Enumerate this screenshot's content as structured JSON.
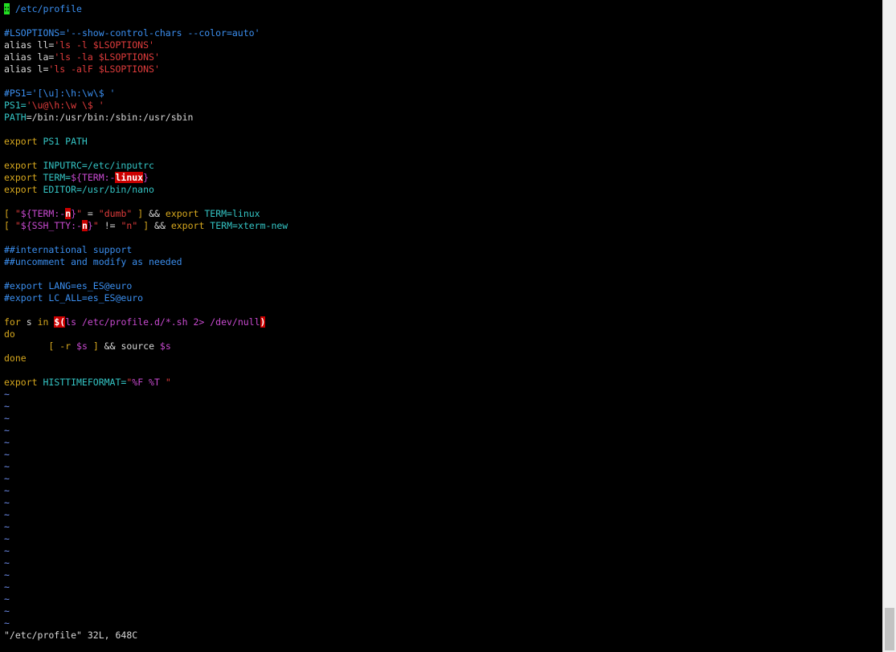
{
  "colors": {
    "background": "#000000",
    "default": "#d8d8d8",
    "comment": "#3b8ff0",
    "string": "#e03c3c",
    "keyword": "#d7a81e",
    "identifier": "#34c5c5",
    "special": "#c84ad0",
    "tilde": "#6f8ff0",
    "highlight_bg": "#cc0000",
    "cursor_bg": "#22e022"
  },
  "editor": {
    "file_name": "/etc/profile",
    "cursor_icon": "block-cursor",
    "status_line": "\"/etc/profile\" 32L, 648C",
    "empty_line_marker": "~",
    "lines": [
      [
        {
          "t": "",
          "c": "cursor"
        },
        {
          "t": " /etc/profile",
          "c": "comment"
        }
      ],
      [],
      [
        {
          "t": "#LSOPTIONS=",
          "c": "comment"
        },
        {
          "t": "'--show-control-chars --color=auto'",
          "c": "comment"
        }
      ],
      [
        {
          "t": "alias ll=",
          "c": "default"
        },
        {
          "t": "'ls -l ",
          "c": "string"
        },
        {
          "t": "$LSOPTIONS",
          "c": "string"
        },
        {
          "t": "'",
          "c": "string"
        }
      ],
      [
        {
          "t": "alias la=",
          "c": "default"
        },
        {
          "t": "'ls -la ",
          "c": "string"
        },
        {
          "t": "$LSOPTIONS",
          "c": "string"
        },
        {
          "t": "'",
          "c": "string"
        }
      ],
      [
        {
          "t": "alias l=",
          "c": "default"
        },
        {
          "t": "'ls -alF ",
          "c": "string"
        },
        {
          "t": "$LSOPTIONS",
          "c": "string"
        },
        {
          "t": "'",
          "c": "string"
        }
      ],
      [],
      [
        {
          "t": "#PS1='[\\u]:\\h:\\w\\$ '",
          "c": "comment"
        }
      ],
      [
        {
          "t": "PS1=",
          "c": "identifier"
        },
        {
          "t": "'\\u@\\h:\\w \\$ '",
          "c": "string"
        }
      ],
      [
        {
          "t": "PATH",
          "c": "identifier"
        },
        {
          "t": "=/bin:/usr/bin:/sbin:/usr/sbin",
          "c": "default"
        }
      ],
      [],
      [
        {
          "t": "export ",
          "c": "keyword"
        },
        {
          "t": "PS1 PATH",
          "c": "identifier"
        }
      ],
      [],
      [
        {
          "t": "export ",
          "c": "keyword"
        },
        {
          "t": "INPUTRC=/etc/inputrc",
          "c": "identifier"
        }
      ],
      [
        {
          "t": "export ",
          "c": "keyword"
        },
        {
          "t": "TERM=",
          "c": "identifier"
        },
        {
          "t": "${TERM:-",
          "c": "special"
        },
        {
          "t": "linux",
          "c": "hl"
        },
        {
          "t": "}",
          "c": "special"
        }
      ],
      [
        {
          "t": "export ",
          "c": "keyword"
        },
        {
          "t": "EDITOR=/usr/bin/nano",
          "c": "identifier"
        }
      ],
      [],
      [
        {
          "t": "[ ",
          "c": "keyword"
        },
        {
          "t": "\"",
          "c": "string"
        },
        {
          "t": "${TERM:-",
          "c": "special"
        },
        {
          "t": "n",
          "c": "hl"
        },
        {
          "t": "}",
          "c": "special"
        },
        {
          "t": "\"",
          "c": "string"
        },
        {
          "t": " = ",
          "c": "default"
        },
        {
          "t": "\"dumb\"",
          "c": "string"
        },
        {
          "t": " ] ",
          "c": "keyword"
        },
        {
          "t": "&& ",
          "c": "default"
        },
        {
          "t": "export ",
          "c": "keyword"
        },
        {
          "t": "TERM=linux",
          "c": "identifier"
        }
      ],
      [
        {
          "t": "[ ",
          "c": "keyword"
        },
        {
          "t": "\"",
          "c": "string"
        },
        {
          "t": "${SSH_TTY:-",
          "c": "special"
        },
        {
          "t": "n",
          "c": "hl"
        },
        {
          "t": "}",
          "c": "special"
        },
        {
          "t": "\"",
          "c": "string"
        },
        {
          "t": " != ",
          "c": "default"
        },
        {
          "t": "\"n\"",
          "c": "string"
        },
        {
          "t": " ] ",
          "c": "keyword"
        },
        {
          "t": "&& ",
          "c": "default"
        },
        {
          "t": "export ",
          "c": "keyword"
        },
        {
          "t": "TERM=xterm-new",
          "c": "identifier"
        }
      ],
      [],
      [
        {
          "t": "##international support",
          "c": "comment"
        }
      ],
      [
        {
          "t": "##uncomment and modify as needed",
          "c": "comment"
        }
      ],
      [],
      [
        {
          "t": "#export LANG=es_ES@euro",
          "c": "comment"
        }
      ],
      [
        {
          "t": "#export LC_ALL=es_ES@euro",
          "c": "comment"
        }
      ],
      [],
      [
        {
          "t": "for ",
          "c": "keyword"
        },
        {
          "t": "s ",
          "c": "default"
        },
        {
          "t": "in ",
          "c": "keyword"
        },
        {
          "t": "$(",
          "c": "hl"
        },
        {
          "t": "ls /etc/profile.d/*.sh 2> /dev/null",
          "c": "special"
        },
        {
          "t": ")",
          "c": "hl"
        }
      ],
      [
        {
          "t": "do",
          "c": "keyword"
        }
      ],
      [
        {
          "t": "        [ ",
          "c": "keyword"
        },
        {
          "t": "-r ",
          "c": "keyword"
        },
        {
          "t": "$s",
          "c": "special"
        },
        {
          "t": " ] ",
          "c": "keyword"
        },
        {
          "t": "&& ",
          "c": "default"
        },
        {
          "t": "source ",
          "c": "default"
        },
        {
          "t": "$s",
          "c": "special"
        }
      ],
      [
        {
          "t": "done",
          "c": "keyword"
        }
      ],
      [],
      [
        {
          "t": "export ",
          "c": "keyword"
        },
        {
          "t": "HISTTIMEFORMAT=",
          "c": "identifier"
        },
        {
          "t": "\"",
          "c": "string"
        },
        {
          "t": "%F %T ",
          "c": "special"
        },
        {
          "t": "\"",
          "c": "string"
        }
      ]
    ],
    "tilde_count": 20
  },
  "scrollbar": {
    "position_fraction": 1.0
  }
}
